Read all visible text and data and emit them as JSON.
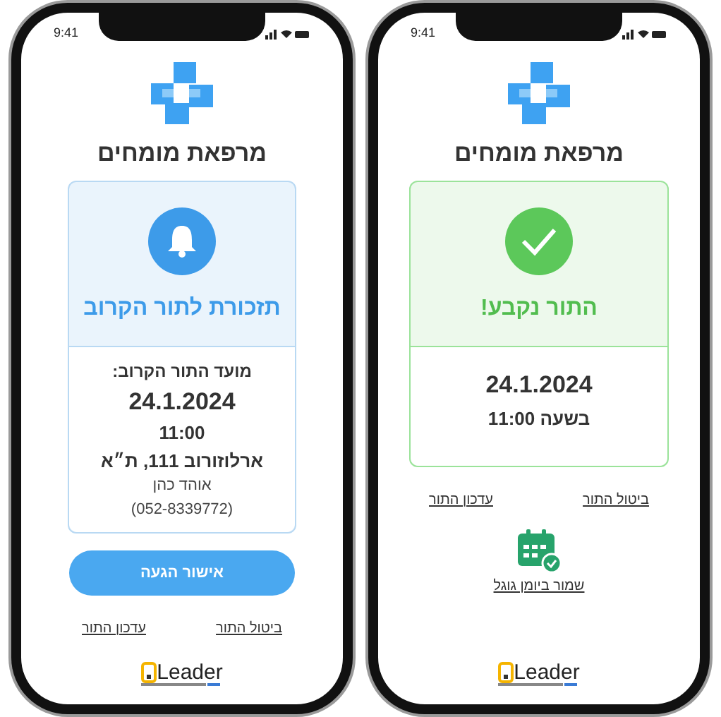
{
  "phones": [
    {
      "kind": "confirmed",
      "status_bar": {
        "time": "9:41"
      },
      "clinic_name": "מרפאת מומחים",
      "card": {
        "title": "התור נקבע!",
        "lines": [
          {
            "kind": "date",
            "text": "24.1.2024"
          },
          {
            "kind": "time",
            "text": "בשעה 11:00"
          }
        ]
      },
      "links": [
        "ביטול התור",
        "עדכון התור"
      ],
      "calendar_link": "שמור ביומן גוגל",
      "footer": {
        "brand": "Leader"
      }
    },
    {
      "kind": "reminder",
      "status_bar": {
        "time": "9:41"
      },
      "clinic_name": "מרפאת מומחים",
      "card": {
        "title": "תזכורת לתור הקרוב",
        "lines": [
          {
            "kind": "label",
            "text": "מועד התור הקרוב:"
          },
          {
            "kind": "date",
            "text": "24.1.2024"
          },
          {
            "kind": "time",
            "text": "11:00"
          },
          {
            "kind": "address",
            "text": "ארלוזורוב 111, ת״א"
          },
          {
            "kind": "plain",
            "text": "אוהד כהן"
          },
          {
            "kind": "plain",
            "text": "(052-8339772)"
          }
        ]
      },
      "primary_button": "אישור הגעה",
      "links": [
        "ביטול התור",
        "עדכון התור"
      ],
      "footer": {
        "brand": "Leader"
      }
    }
  ]
}
